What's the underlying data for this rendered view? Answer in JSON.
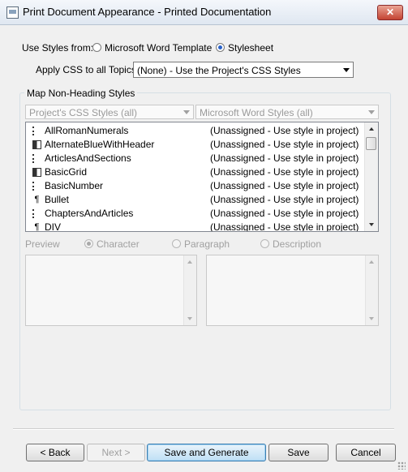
{
  "window": {
    "title": "Print Document Appearance - Printed Documentation",
    "close_label": "✕"
  },
  "styles_from": {
    "label": "Use Styles from:",
    "options": [
      "Microsoft Word Template",
      "Stylesheet"
    ],
    "selected": "Stylesheet"
  },
  "apply_css": {
    "label": "Apply CSS to all Topics:",
    "value": "(None) - Use the Project's CSS Styles"
  },
  "map_group": {
    "label": "Map Non-Heading Styles",
    "col_css": "Project's CSS Styles (all)",
    "col_word": "Microsoft Word Styles (all)",
    "rows": [
      {
        "icon": "list-style-icon",
        "name": "AllRomanNumerals",
        "map": "(Unassigned - Use style in project)"
      },
      {
        "icon": "table-style-icon",
        "name": "AlternateBlueWithHeader",
        "map": "(Unassigned - Use style in project)"
      },
      {
        "icon": "list-style-icon",
        "name": "ArticlesAndSections",
        "map": "(Unassigned - Use style in project)"
      },
      {
        "icon": "table-style-icon",
        "name": "BasicGrid",
        "map": "(Unassigned - Use style in project)"
      },
      {
        "icon": "list-style-icon",
        "name": "BasicNumber",
        "map": "(Unassigned - Use style in project)"
      },
      {
        "icon": "paragraph-style-icon",
        "name": "Bullet",
        "map": "(Unassigned - Use style in project)"
      },
      {
        "icon": "list-style-icon",
        "name": "ChaptersAndArticles",
        "map": "(Unassigned - Use style in project)"
      },
      {
        "icon": "paragraph-style-icon",
        "name": "DIV",
        "map": "(Unassigned - Use style in project)"
      }
    ]
  },
  "preview": {
    "label": "Preview",
    "options": [
      "Character",
      "Paragraph",
      "Description"
    ],
    "selected": "Character"
  },
  "buttons": {
    "back": "< Back",
    "next": "Next >",
    "save_generate": "Save and Generate",
    "save": "Save",
    "cancel": "Cancel"
  }
}
